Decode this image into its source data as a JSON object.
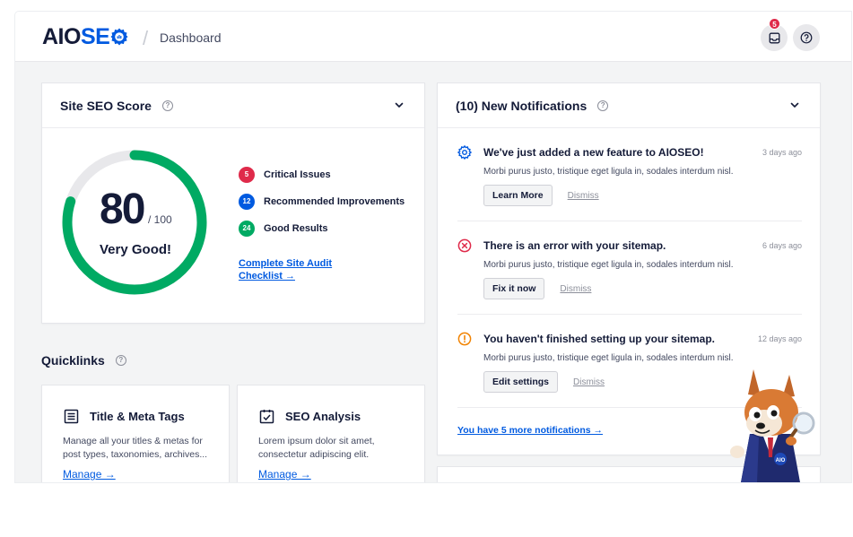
{
  "header": {
    "logo_aio": "AIO",
    "logo_seo": "SE",
    "separator": "/",
    "breadcrumb": "Dashboard",
    "notifications_badge": "5",
    "help_label": "?"
  },
  "score_card": {
    "title": "Site SEO Score",
    "help": "?",
    "score": "80",
    "score_max": "/ 100",
    "score_fraction": 0.8,
    "score_label": "Very Good!",
    "gauge_color": "#00aa63",
    "gauge_track": "#e8e8eb",
    "stats": [
      {
        "count": "5",
        "label": "Critical Issues",
        "color": "#df2a4a"
      },
      {
        "count": "12",
        "label": "Recommended Improvements",
        "color": "#005ae0"
      },
      {
        "count": "24",
        "label": "Good Results",
        "color": "#00aa63"
      }
    ],
    "audit_link": "Complete Site Audit Checklist →"
  },
  "quicklinks": {
    "title": "Quicklinks",
    "help": "?",
    "items": [
      {
        "icon": "title-meta-icon",
        "title": "Title & Meta Tags",
        "description": "Manage all your titles & metas for post types, taxonomies, archives...",
        "link": "Manage →"
      },
      {
        "icon": "seo-analysis-icon",
        "title": "SEO Analysis",
        "description": "Lorem ipsum dolor sit amet, consectetur adipiscing elit.",
        "link": "Manage →"
      }
    ]
  },
  "notifications": {
    "title": "(10) New Notifications",
    "help": "?",
    "items": [
      {
        "icon": "gear-icon",
        "icon_color": "#005ae0",
        "title": "We've just added a new feature to AIOSEO!",
        "time": "3 days ago",
        "description": "Morbi purus justo, tristique eget ligula in, sodales interdum nisl.",
        "action": "Learn More",
        "dismiss": "Dismiss"
      },
      {
        "icon": "error-icon",
        "icon_color": "#df2a4a",
        "title": "There is an error with your sitemap.",
        "time": "6 days ago",
        "description": "Morbi purus justo, tristique eget ligula in, sodales interdum nisl.",
        "action": "Fix it now",
        "dismiss": "Dismiss"
      },
      {
        "icon": "warning-icon",
        "icon_color": "#f18200",
        "title": "You haven't finished setting up your sitemap.",
        "time": "12 days ago",
        "description": "Morbi purus justo, tristique eget ligula in, sodales interdum nisl.",
        "action": "Edit settings",
        "dismiss": "Dismiss"
      }
    ],
    "more_link": "You have 5 more notifications →"
  },
  "mascot": {
    "badge": "AIO"
  }
}
